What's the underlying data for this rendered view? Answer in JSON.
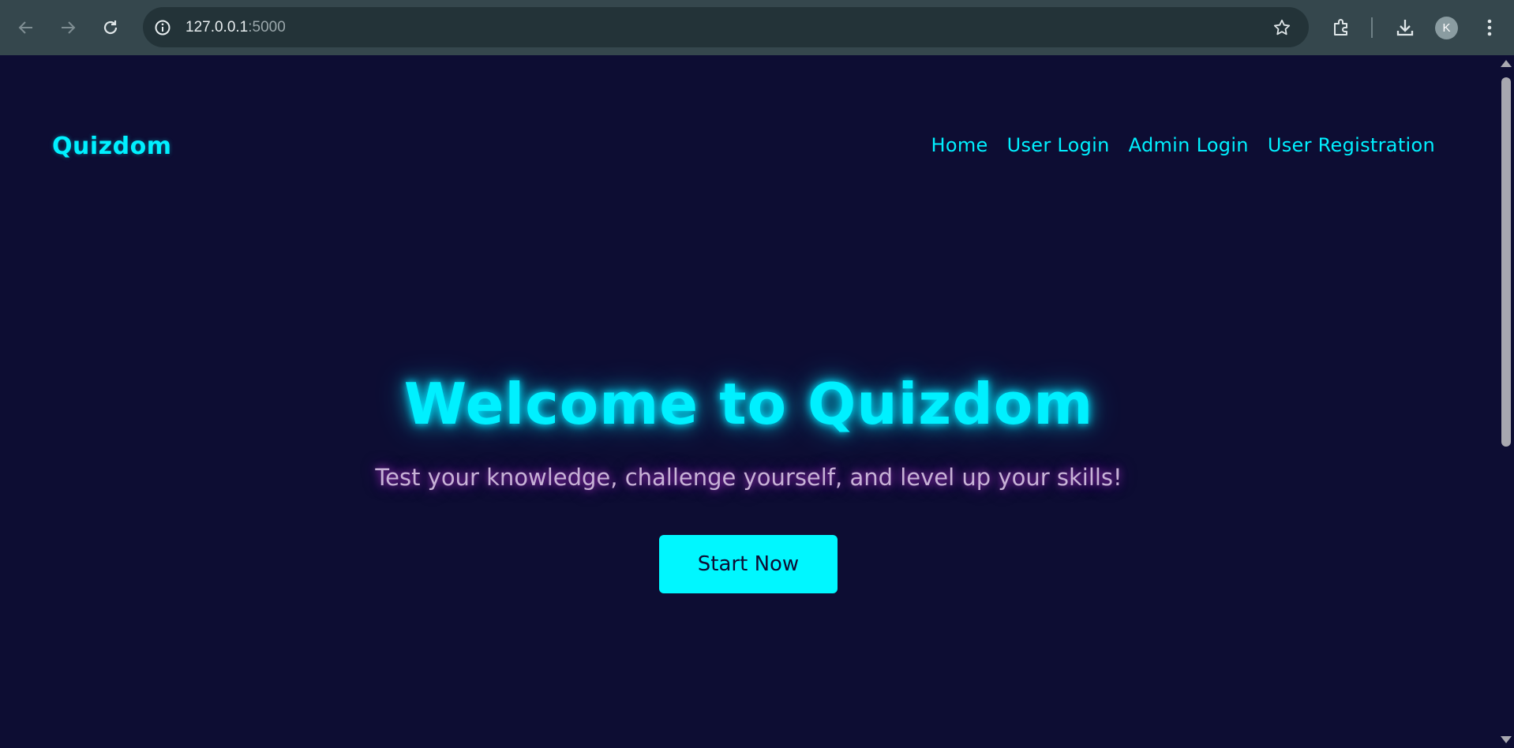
{
  "browser": {
    "url_host": "127.0.0.1",
    "url_port": ":5000",
    "profile_initial": "K"
  },
  "site": {
    "logo": "Quizdom",
    "nav": {
      "home": "Home",
      "user_login": "User Login",
      "admin_login": "Admin Login",
      "user_registration": "User Registration"
    }
  },
  "hero": {
    "title": "Welcome to Quizdom",
    "subtitle": "Test your knowledge, challenge yourself, and level up your skills!",
    "cta": "Start Now"
  },
  "colors": {
    "page_background": "#0d0d33",
    "accent_cyan": "#00f0ff",
    "subtitle_glow": "#c83ce6",
    "browser_chrome": "#35474d"
  },
  "icons": [
    "back-icon",
    "forward-icon",
    "reload-icon",
    "site-info-icon",
    "bookmark-star-icon",
    "extensions-icon",
    "download-icon",
    "menu-kebab-icon"
  ]
}
